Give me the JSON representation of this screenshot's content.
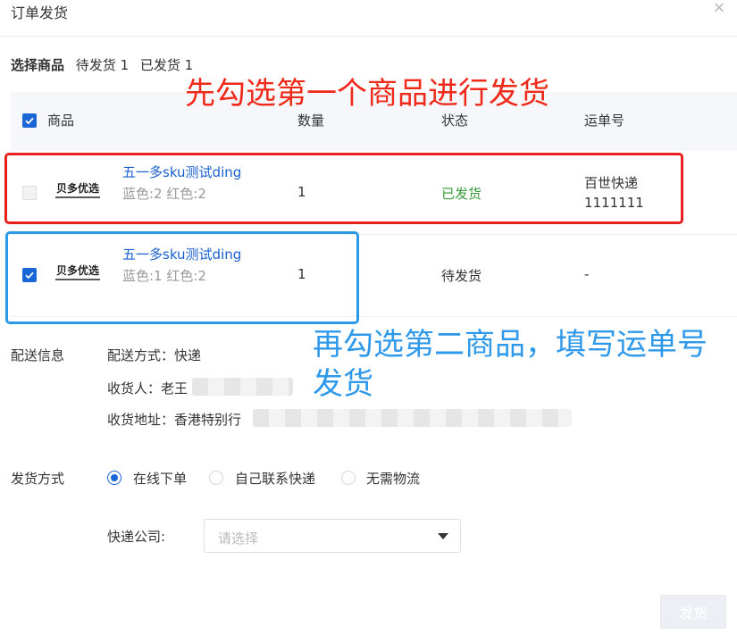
{
  "dialog": {
    "title": "订单发货",
    "close_glyph": "×"
  },
  "selection": {
    "title": "选择商品",
    "pending": "待发货 1",
    "shipped": "已发货 1"
  },
  "table": {
    "columns": [
      "商品",
      "数量",
      "状态",
      "运单号"
    ],
    "rows": [
      {
        "checked": false,
        "disabled": true,
        "logo_text": "贝多优选",
        "name": "五一多sku测试ding",
        "spec": "蓝色:2 红色:2",
        "qty": "1",
        "status": "已发货",
        "carrier": "百世快递",
        "tracking": "1111111"
      },
      {
        "checked": true,
        "disabled": false,
        "logo_text": "贝多优选",
        "name": "五一多sku测试ding",
        "spec": "蓝色:1 红色:2",
        "qty": "1",
        "status": "待发货",
        "tracking": "-"
      }
    ]
  },
  "annotations": {
    "red": "先勾选第一个商品进行发货",
    "blue": "再勾选第二商品，填写运单号发货"
  },
  "delivery_info": {
    "label": "配送信息",
    "method": "配送方式：快递",
    "receiver": "收货人：老王",
    "address": "收货地址：香港特别行"
  },
  "ship_method": {
    "label": "发货方式",
    "options": [
      {
        "label": "在线下单",
        "selected": true
      },
      {
        "label": "自己联系快递",
        "selected": false
      },
      {
        "label": "无需物流",
        "selected": false
      }
    ]
  },
  "courier": {
    "label": "快递公司:",
    "placeholder": "请选择"
  },
  "submit_label": "发货",
  "colors": {
    "primary": "#1b66d6",
    "link": "#1a5fd0",
    "success": "#3a9a3a",
    "annot_red": "#ef2a1a",
    "annot_blue": "#2e98ea"
  }
}
